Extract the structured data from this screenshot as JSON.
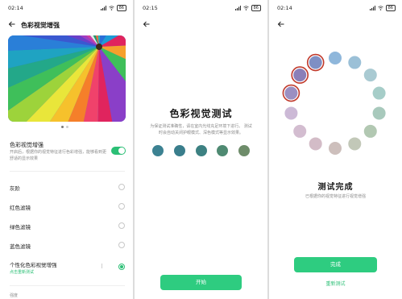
{
  "panel1": {
    "status": {
      "time": "02:14",
      "battery": "86"
    },
    "title": "色彩视觉增强",
    "carousel_pages": 2,
    "carousel_active": 0,
    "enhance": {
      "title": "色彩视觉增强",
      "desc": "开启后，根据你的视觉特征进行色彩增强，能够看到更舒适的显示效果",
      "enabled": true
    },
    "options": [
      {
        "label": "灰阶",
        "selected": false
      },
      {
        "label": "红色滤镜",
        "selected": false
      },
      {
        "label": "绿色滤镜",
        "selected": false
      },
      {
        "label": "蓝色滤镜",
        "selected": false
      },
      {
        "label": "个性化色彩视觉增强",
        "selected": true
      }
    ],
    "personal_sub": "点击重新测试",
    "section_label": "强度"
  },
  "panel2": {
    "status": {
      "time": "02:15",
      "battery": "86"
    },
    "title": "色彩视觉测试",
    "desc": "为保证测试准确性，请在室内光线充足环境下进行。 测试时会自动关闭护眼模式、深色模式等显示效果。",
    "swatches": [
      "#3c8292",
      "#3a7e8c",
      "#3d8182",
      "#4f8a72",
      "#6e8c6a"
    ],
    "start_label": "开始"
  },
  "panel3": {
    "status": {
      "time": "02:14",
      "battery": "86"
    },
    "ring_colors": [
      "#8fb7db",
      "#9bc0d7",
      "#a9cad2",
      "#a6cdc8",
      "#a8c9bc",
      "#b2c8b2",
      "#c2c8b8",
      "#cdbfbc",
      "#d3bcc7",
      "#d3bdd0",
      "#ccb9d6",
      "#9b8fc2",
      "#8a7fb8",
      "#7e8fc4"
    ],
    "selected_ring_indices": [
      11,
      12,
      13
    ],
    "done_title": "测试完成",
    "done_desc": "已根据你的视觉特征进行视觉增强",
    "done_label": "完成",
    "retest_label": "重新测试"
  },
  "colors": {
    "accent": "#2bbf75",
    "button": "#2ecc80",
    "ring_highlight": "#c0392b"
  }
}
